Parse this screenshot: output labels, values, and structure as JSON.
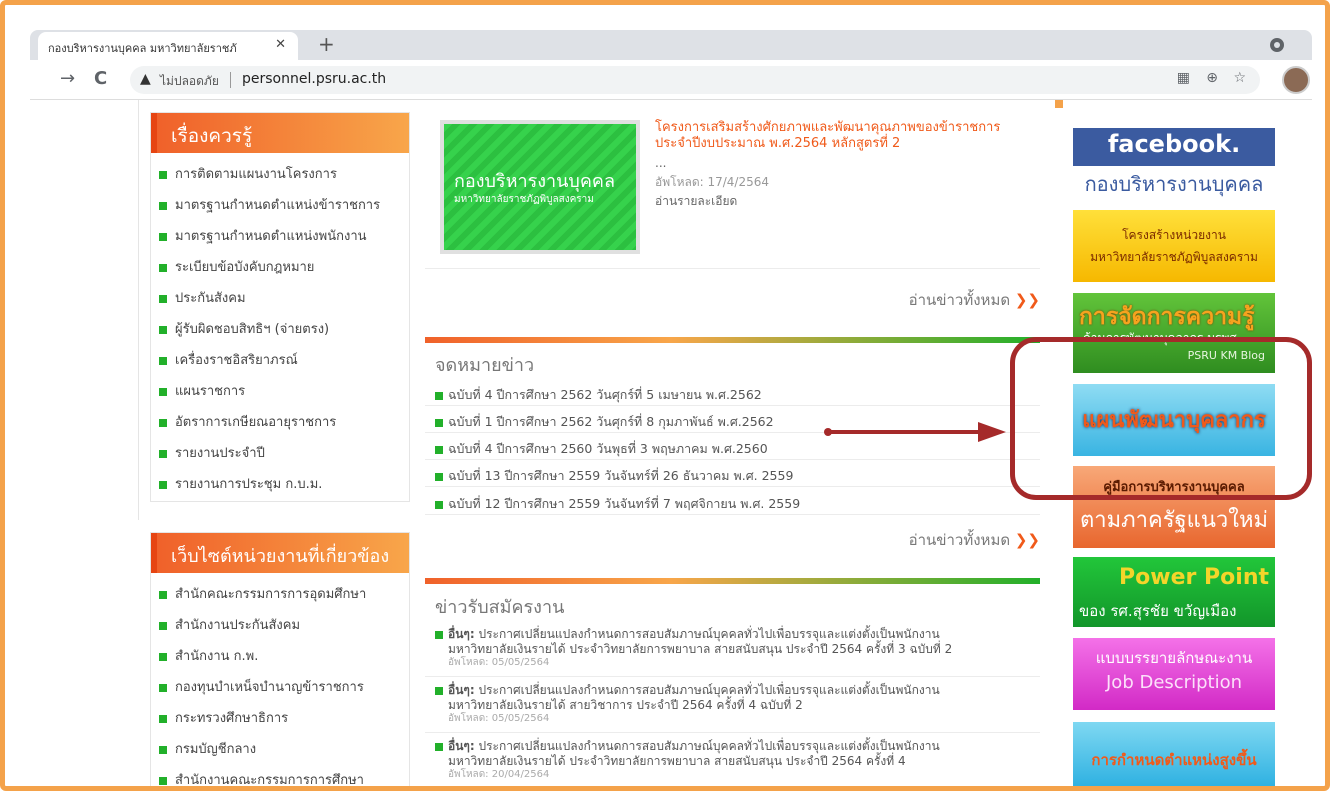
{
  "browser": {
    "tab_title": "กองบริหารงานบุคคล มหาวิทยาลัยราชภั",
    "tab_close": "✕",
    "new_tab": "+",
    "back": "→",
    "reload": "C",
    "security_label": "ไม่ปลอดภัย",
    "url": "personnel.psru.ac.th"
  },
  "sidebar_knowledge": {
    "heading": "เรื่องควรรู้",
    "items": [
      "การติดตามแผนงานโครงการ",
      "มาตรฐานกำหนดตำแหน่งข้าราชการ",
      "มาตรฐานกำหนดตำแหน่งพนักงาน",
      "ระเบียบข้อบังคับกฎหมาย",
      "ประกันสังคม",
      "ผู้รับผิดชอบสิทธิฯ (จ่ายตรง)",
      "เครื่องราชอิสริยาภรณ์",
      "แผนราชการ",
      "อัตราการเกษียณอายุราชการ",
      "รายงานประจำปี",
      "รายงานการประชุม ก.บ.ม."
    ]
  },
  "sidebar_links": {
    "heading": "เว็บไซต์หน่วยงานที่เกี่ยวข้อง",
    "items": [
      "สำนักคณะกรรมการการอุดมศึกษา",
      "สำนักงานประกันสังคม",
      "สำนักงาน ก.พ.",
      "กองทุนบำเหน็จบำนาญข้าราชการ",
      "กระทรวงศึกษาธิการ",
      "กรมบัญชีกลาง",
      "สำนักงานคณะกรรมการการศึกษา"
    ]
  },
  "featured": {
    "image_title": "กองบริหารงานบุคคล",
    "image_subtitle": "มหาวิทยาลัยราชภัฏพิบูลสงคราม",
    "title": "โครงการเสริมสร้างศักยภาพและพัฒนาคุณภาพของข้าราชการ ประจำปีงบประมาณ พ.ศ.2564 หลักสูตรที่ 2",
    "ellipsis": "...",
    "upload_date": "อัพโหลด: 17/4/2564",
    "read_more": "อ่านรายละเอียด"
  },
  "read_all": "อ่านข่าวทั้งหมด",
  "newsletter": {
    "heading": "จดหมายข่าว",
    "items": [
      "ฉบับที่ 4 ปีการศึกษา 2562 วันศุกร์ที่ 5 เมษายน พ.ศ.2562",
      "ฉบับที่ 1 ปีการศึกษา 2562 วันศุกร์ที่ 8 กุมภาพันธ์ พ.ศ.2562",
      "ฉบับที่ 4 ปีการศึกษา 2560 วันพุธที่ 3 พฤษภาคม พ.ศ.2560",
      "ฉบับที่ 13 ปีการศึกษา 2559 วันจันทร์ที่ 26 ธันวาคม พ.ศ. 2559",
      "ฉบับที่ 12 ปีการศึกษา 2559 วันจันทร์ที่ 7 พฤศจิกายน พ.ศ. 2559"
    ]
  },
  "jobs": {
    "heading": "ข่าวรับสมัครงาน",
    "items": [
      {
        "category": "อื่นๆ:",
        "line1": "ประกาศเปลี่ยนแปลงกำหนดการสอบสัมภาษณ์บุคคลทั่วไปเพื่อบรรจุและแต่งตั้งเป็นพนักงาน",
        "line2": "มหาวิทยาลัยเงินรายได้ ประจำวิทยาลัยการพยาบาล สายสนับสนุน ประจำปี 2564 ครั้งที่ 3 ฉบับที่ 2",
        "date": "อัพโหลด: 05/05/2564"
      },
      {
        "category": "อื่นๆ:",
        "line1": "ประกาศเปลี่ยนแปลงกำหนดการสอบสัมภาษณ์บุคคลทั่วไปเพื่อบรรจุและแต่งตั้งเป็นพนักงาน",
        "line2": "มหาวิทยาลัยเงินรายได้ สายวิชาการ ประจำปี 2564 ครั้งที่ 4 ฉบับที่ 2",
        "date": "อัพโหลด: 05/05/2564"
      },
      {
        "category": "อื่นๆ:",
        "line1": "ประกาศเปลี่ยนแปลงกำหนดการสอบสัมภาษณ์บุคคลทั่วไปเพื่อบรรจุและแต่งตั้งเป็นพนักงาน",
        "line2": "มหาวิทยาลัยเงินรายได้ ประจำวิทยาลัยการพยาบาล สายสนับสนุน ประจำปี 2564 ครั้งที่ 4",
        "date": "อัพโหลด: 20/04/2564"
      }
    ]
  },
  "banners": {
    "facebook_1": "facebook.",
    "facebook_2": "กองบริหารงานบุคคล",
    "org_1": "โครงสร้างหน่วยงาน",
    "org_2": "มหาวิทยาลัยราชภัฏพิบูลสงคราม",
    "km_1": "การจัดการความรู้",
    "km_2": "ด้านการพัฒนาบุคลากร มรพส.",
    "km_3": "PSRU KM Blog",
    "plan": "แผนพัฒนาบุคลากร",
    "manual_1": "คู่มือการบริหารงานบุคคล",
    "manual_2": "ตามภาครัฐแนวใหม่",
    "pp_1": "Power Point",
    "pp_2": "ของ รศ.สุรชัย ขวัญเมือง",
    "job_1": "แบบบรรยายลักษณะงาน",
    "job_2": "Job Description",
    "pos": "การกำหนดตำแหน่งสูงขึ้น"
  },
  "colors": {
    "accent_orange": "#f05a1a",
    "accent_green": "#22b02a",
    "annotation": "#a52a2a",
    "frame": "#f4a24a"
  }
}
